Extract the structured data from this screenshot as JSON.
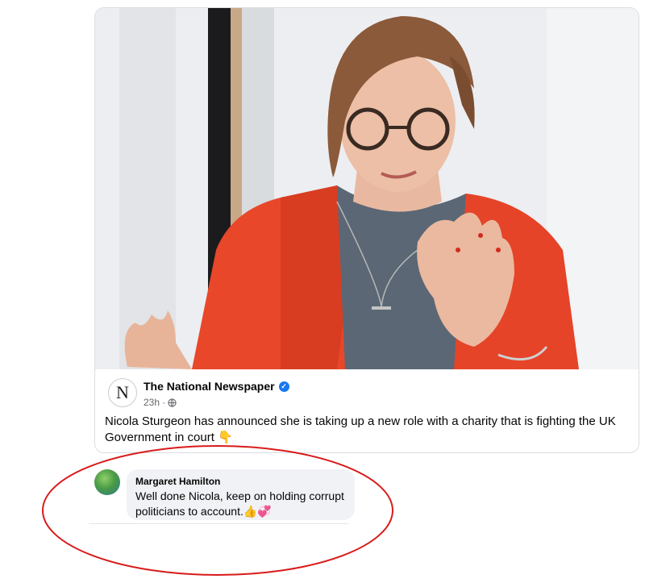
{
  "post": {
    "page_name": "The National Newspaper",
    "page_initial": "N",
    "timestamp": "23h ·",
    "text": "Nicola Sturgeon has announced she is taking up a new role with a charity that is fighting the UK Government in court 👇"
  },
  "comment": {
    "author": "Margaret Hamilton",
    "text": "Well done Nicola, keep on holding corrupt politicians to account.👍💞"
  },
  "icons": {
    "verified": "verified-badge-icon",
    "audience": "globe-icon"
  },
  "colors": {
    "verified_blue": "#1877f2",
    "annotation_red": "#d81b1b",
    "jacket_orange": "#e8472a",
    "bubble_gray": "#f0f2f5"
  }
}
